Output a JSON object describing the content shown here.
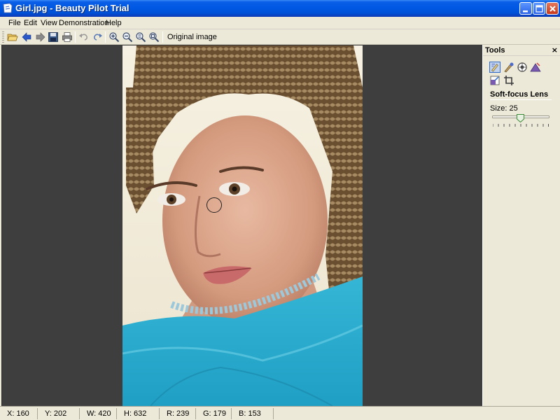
{
  "window": {
    "title": "Girl.jpg - Beauty Pilot Trial"
  },
  "menu": {
    "items": [
      "File",
      "Edit",
      "View",
      "Demonstration",
      "Help"
    ]
  },
  "toolbar": {
    "icons": [
      "open-icon",
      "back-icon",
      "forward-icon",
      "save-icon",
      "print-icon",
      "undo-icon",
      "redo-icon",
      "zoom-in-icon",
      "zoom-out-icon",
      "zoom-fit-icon",
      "zoom-actual-icon"
    ],
    "original_image_label": "Original image"
  },
  "tools_panel": {
    "title": "Tools",
    "close_glyph": "×",
    "tools": [
      "soft-focus-lens-tool-icon",
      "retouch-tool-icon",
      "red-eye-tool-icon",
      "sharpen-tool-icon",
      "resize-tool-icon",
      "crop-tool-icon"
    ],
    "active_tool": "Soft-focus Lens",
    "size_label": "Size: 25",
    "size_value": 25
  },
  "status": {
    "x": "X: 160",
    "y": "Y: 202",
    "w": "W: 420",
    "h": "H: 632",
    "r": "R: 239",
    "g": "G: 179",
    "b": "B: 153"
  },
  "colors": {
    "titlebar": "#0054e3",
    "canvas_bg": "#3e3e3e",
    "chrome": "#ece9d8"
  }
}
